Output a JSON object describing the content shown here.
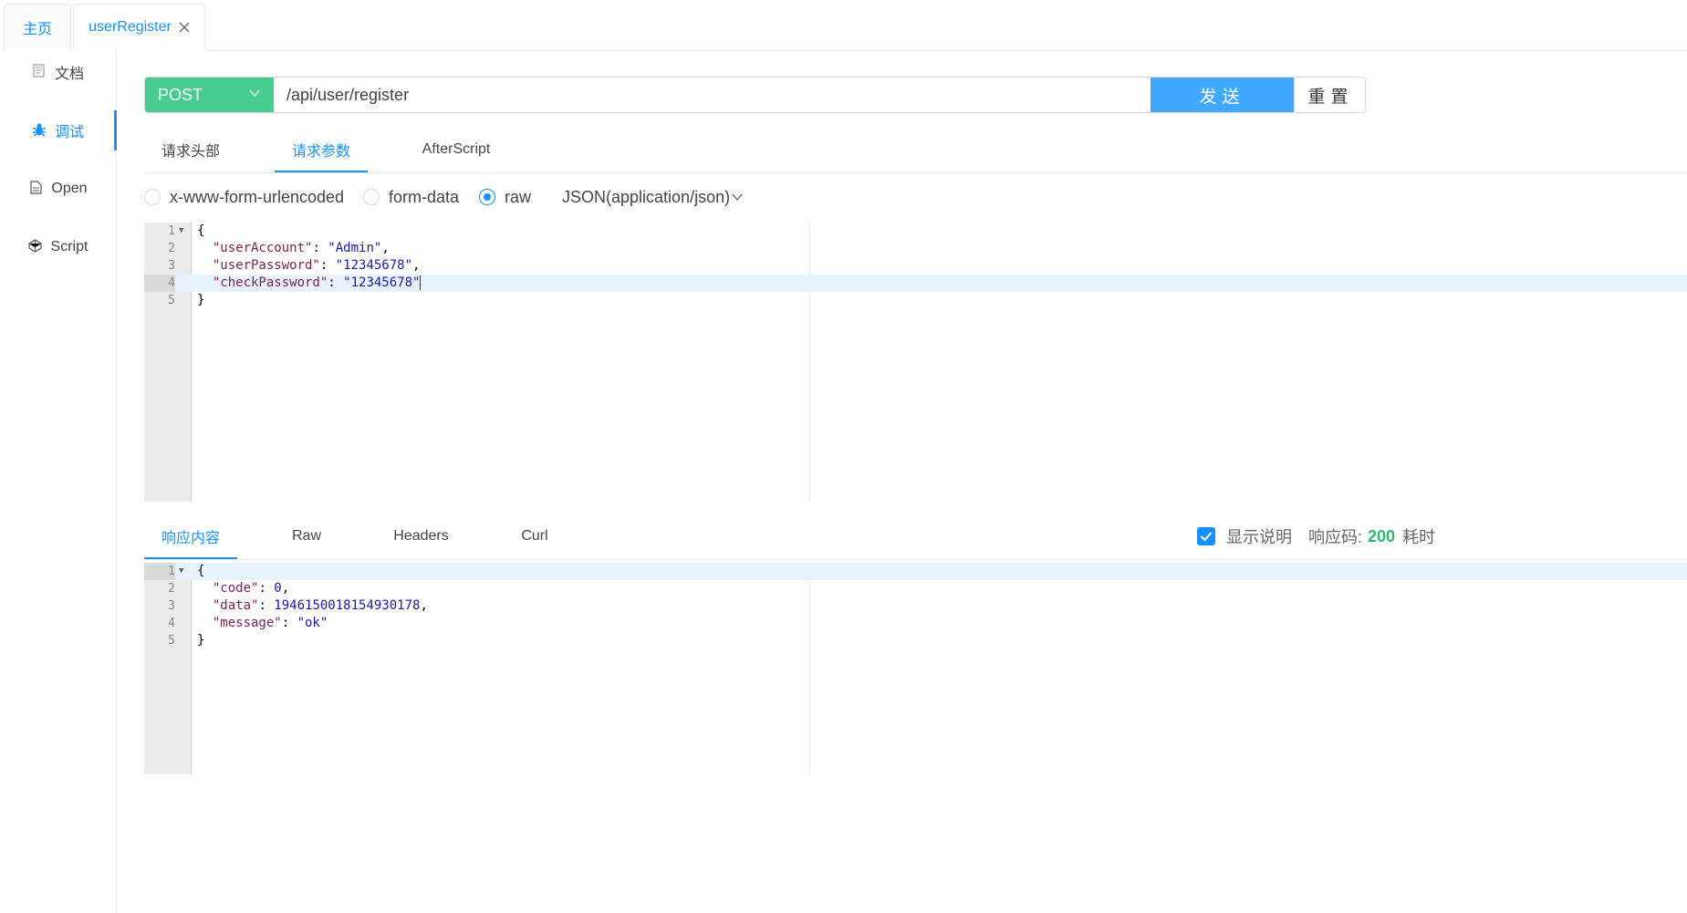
{
  "tabs": {
    "home": "主页",
    "active": "userRegister",
    "close_glyph": "╳"
  },
  "sidebar": {
    "items": [
      {
        "label": "文档",
        "icon": "document-icon"
      },
      {
        "label": "调试",
        "icon": "bug-icon"
      },
      {
        "label": "Open",
        "icon": "file-icon"
      },
      {
        "label": "Script",
        "icon": "codepen-icon"
      }
    ]
  },
  "request": {
    "method": "POST",
    "url": "/api/user/register",
    "send_label": "发送",
    "reset_label": "重置"
  },
  "subtabs": [
    "请求头部",
    "请求参数",
    "AfterScript"
  ],
  "body_types": {
    "options": [
      "x-www-form-urlencoded",
      "form-data",
      "raw"
    ],
    "selected": "raw",
    "content_type": "JSON(application/json)"
  },
  "request_body": {
    "line_numbers": [
      "1",
      "2",
      "3",
      "4",
      "5"
    ],
    "open": "{",
    "close": "}",
    "fields": [
      {
        "key": "\"userAccount\"",
        "value": "\"Admin\"",
        "comma": ","
      },
      {
        "key": "\"userPassword\"",
        "value": "\"12345678\"",
        "comma": ","
      },
      {
        "key": "\"checkPassword\"",
        "value": "\"12345678\"",
        "comma": ""
      }
    ]
  },
  "response_tabs": [
    "响应内容",
    "Raw",
    "Headers",
    "Curl"
  ],
  "response_meta": {
    "show_desc_label": "显示说明",
    "status_label": "响应码:",
    "status_code": "200",
    "time_label": "耗时"
  },
  "response_body": {
    "line_numbers": [
      "1",
      "2",
      "3",
      "4",
      "5"
    ],
    "open": "{",
    "close": "}",
    "fields": [
      {
        "key": "\"code\"",
        "value": "0",
        "comma": ","
      },
      {
        "key": "\"data\"",
        "value": "1946150018154930178",
        "comma": ","
      },
      {
        "key": "\"message\"",
        "value": "\"ok\"",
        "comma": ""
      }
    ]
  },
  "colors": {
    "accent": "#1890ff",
    "post_method": "#49cc90",
    "send_button": "#40a9ff",
    "status_ok": "#2eb872"
  }
}
